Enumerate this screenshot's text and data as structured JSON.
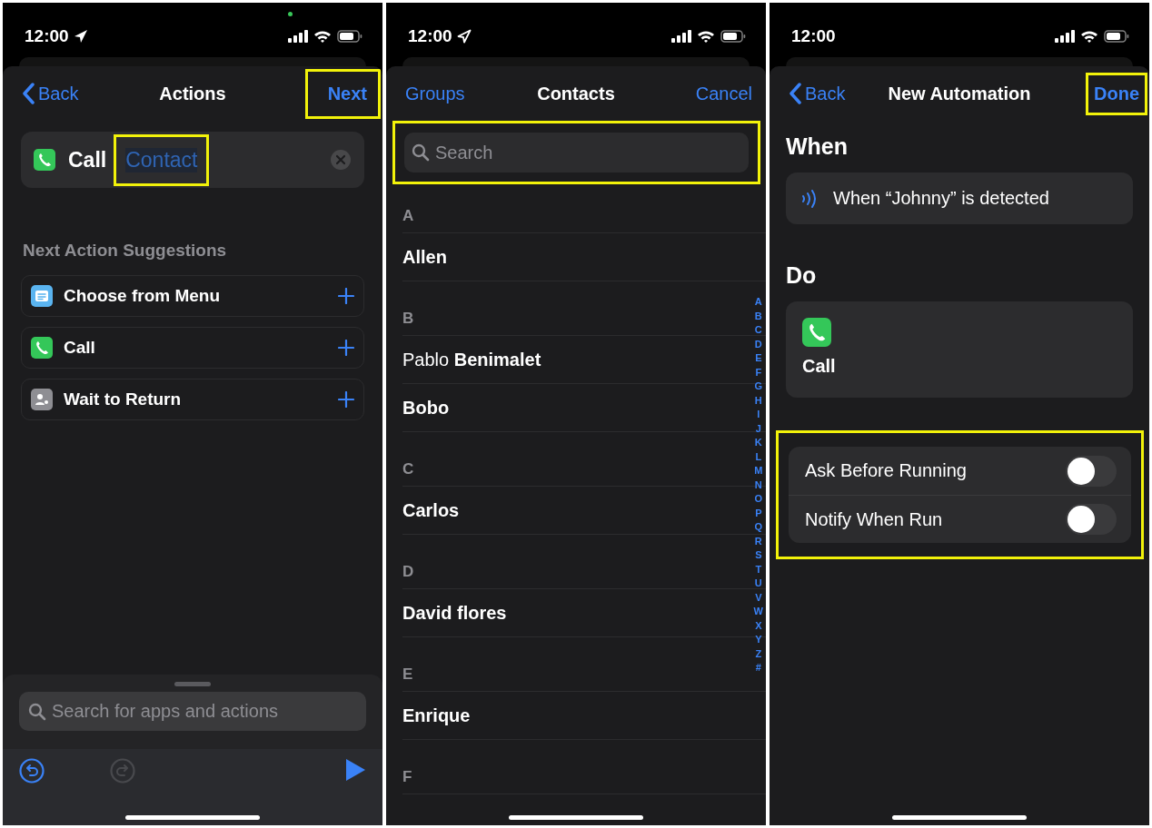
{
  "screens": [
    {
      "kind": "actions",
      "status": {
        "time": "12:00",
        "location_arrow": {
          "filled": true
        },
        "privacy_dot": true
      },
      "nav": {
        "back": "Back",
        "title": "Actions",
        "action": "Next",
        "action_highlighted": true
      },
      "action_block": {
        "verb": "Call",
        "parameter": "Contact",
        "parameter_highlighted": true
      },
      "suggestions_title": "Next Action Suggestions",
      "suggestions": [
        {
          "label": "Choose from Menu",
          "kind": "menu"
        },
        {
          "label": "Call",
          "kind": "phone"
        },
        {
          "label": "Wait to Return",
          "kind": "return"
        }
      ],
      "search": {
        "placeholder": "Search for apps and actions"
      },
      "undo_enabled": true,
      "redo_enabled": false
    },
    {
      "kind": "contacts",
      "status": {
        "time": "12:00",
        "location_arrow": {
          "filled": false
        }
      },
      "nav": {
        "left": "Groups",
        "title": "Contacts",
        "right": "Cancel"
      },
      "search": {
        "placeholder": "Search",
        "highlighted": true
      },
      "sections": [
        {
          "letter": "A",
          "contacts": [
            {
              "last": "Allen"
            }
          ]
        },
        {
          "letter": "B",
          "contacts": [
            {
              "first": "Pablo",
              "last": "Benimalet"
            },
            {
              "last": "Bobo"
            }
          ]
        },
        {
          "letter": "C",
          "contacts": [
            {
              "last": "Carlos"
            }
          ]
        },
        {
          "letter": "D",
          "contacts": [
            {
              "last": "David flores"
            }
          ]
        },
        {
          "letter": "E",
          "contacts": [
            {
              "last": "Enrique"
            }
          ]
        },
        {
          "letter": "F"
        }
      ],
      "index": [
        "A",
        "B",
        "C",
        "D",
        "E",
        "F",
        "G",
        "H",
        "I",
        "J",
        "K",
        "L",
        "M",
        "N",
        "O",
        "P",
        "Q",
        "R",
        "S",
        "T",
        "U",
        "V",
        "W",
        "X",
        "Y",
        "Z",
        "#"
      ]
    },
    {
      "kind": "automation",
      "status": {
        "time": "12:00"
      },
      "nav": {
        "back": "Back",
        "title": "New Automation",
        "action": "Done",
        "action_highlighted": true
      },
      "when_heading": "When",
      "trigger": "When “Johnny” is detected",
      "do_heading": "Do",
      "action": "Call",
      "toggles_highlighted": true,
      "toggles": [
        {
          "label": "Ask Before Running",
          "on": false
        },
        {
          "label": "Notify When Run",
          "on": false
        }
      ]
    }
  ]
}
